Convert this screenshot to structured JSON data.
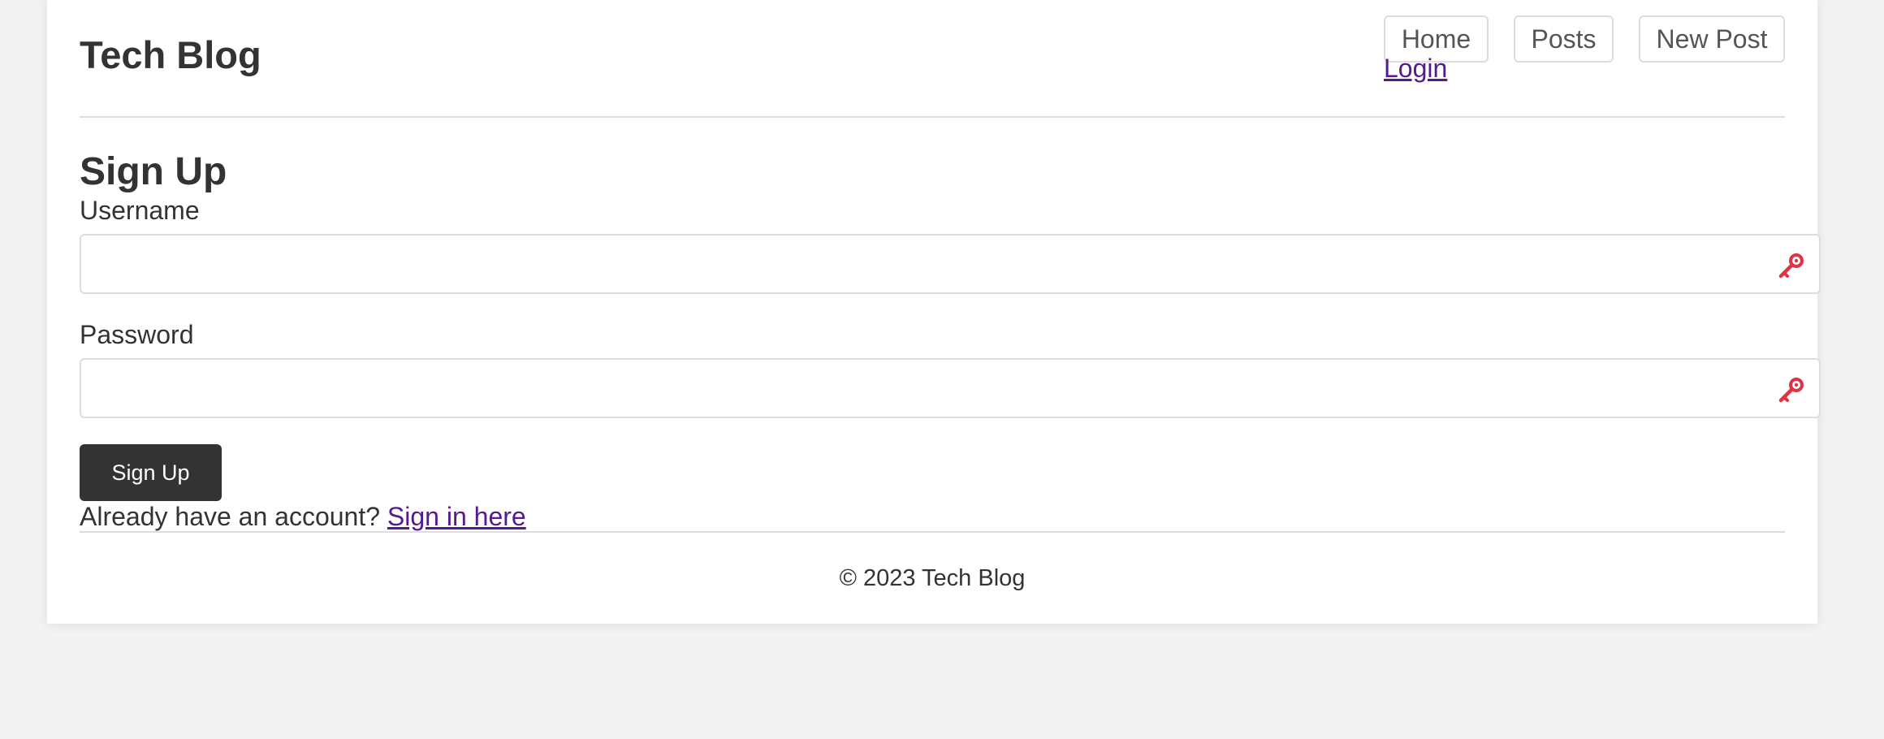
{
  "header": {
    "site_title": "Tech Blog",
    "nav": {
      "home": "Home",
      "posts": "Posts",
      "new_post": "New Post",
      "login": "Login"
    }
  },
  "form": {
    "heading": "Sign Up",
    "username": {
      "label": "Username",
      "value": "",
      "icon": "key-icon"
    },
    "password": {
      "label": "Password",
      "value": "",
      "icon": "key-icon"
    },
    "submit_label": "Sign Up",
    "signin_prompt": "Already have an account?",
    "signin_link": "Sign in here"
  },
  "footer": {
    "text": "© 2023 Tech Blog"
  },
  "colors": {
    "page_background": "#f3f3f3",
    "card_background": "#ffffff",
    "text": "#333333",
    "link_visited": "#551a8b",
    "button_background": "#333333",
    "key_icon": "#dc3545",
    "border": "#dddddd"
  }
}
